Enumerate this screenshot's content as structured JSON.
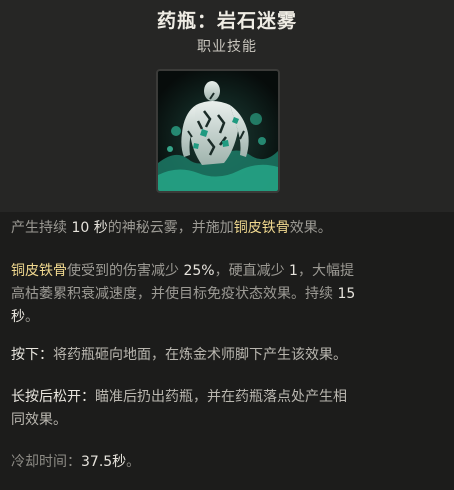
{
  "header": {
    "title": "药瓶：岩石迷雾",
    "subtitle": "职业技能",
    "icon": "stone-skin-figure-icon"
  },
  "description": {
    "p1": {
      "a": "产生持续 ",
      "b": "10",
      "c": " 秒",
      "d": "的神秘云雾，并施加",
      "e": "铜皮铁骨",
      "f": "效果。"
    },
    "p2": {
      "a": "铜皮铁骨",
      "b": "使受到的伤害减少 ",
      "c": "25%",
      "d": "，硬直减少 ",
      "e": "1",
      "f": "，大幅提",
      "g": "高枯萎累积衰减速度，并使目标免疫状态效果。持续 ",
      "h": "15",
      "i": "秒",
      "j": "。"
    },
    "p3": {
      "label": "按下：",
      "text": "将药瓶砸向地面，在炼金术师脚下产生该效果。"
    },
    "p4": {
      "label": "长按后松开：",
      "text_1": "瞄准后扔出药瓶，并在药瓶落点处产生相",
      "text_2": "同效果。"
    },
    "cooldown": {
      "label": "冷却时间：",
      "value": "37.5秒",
      "end": "。"
    }
  },
  "colors": {
    "keyword": "#f0d88f",
    "number": "#e6e3dc",
    "text": "#9c9a94",
    "icon_teal": "#1f9a80"
  }
}
